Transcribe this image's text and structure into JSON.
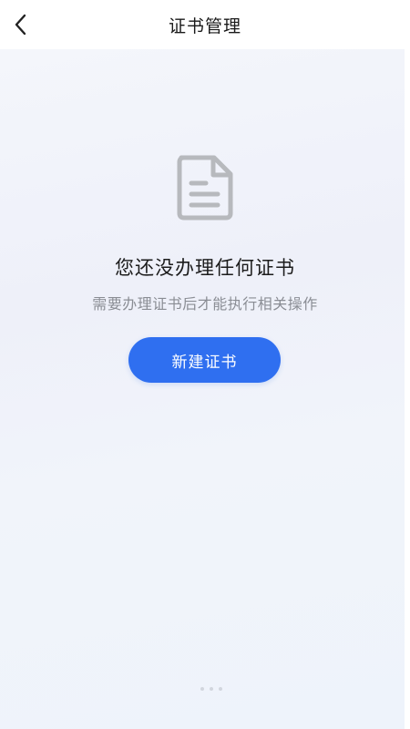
{
  "header": {
    "title": "证书管理",
    "back_icon": "chevron-left-icon"
  },
  "empty_state": {
    "icon": "document-icon",
    "title": "您还没办理任何证书",
    "subtitle": "需要办理证书后才能执行相关操作",
    "button_label": "新建证书"
  },
  "colors": {
    "accent": "#2f6ff0",
    "icon_gray": "#b7b9bd",
    "title_text": "#1c1c1c",
    "subtitle_text": "#8a8d94"
  }
}
